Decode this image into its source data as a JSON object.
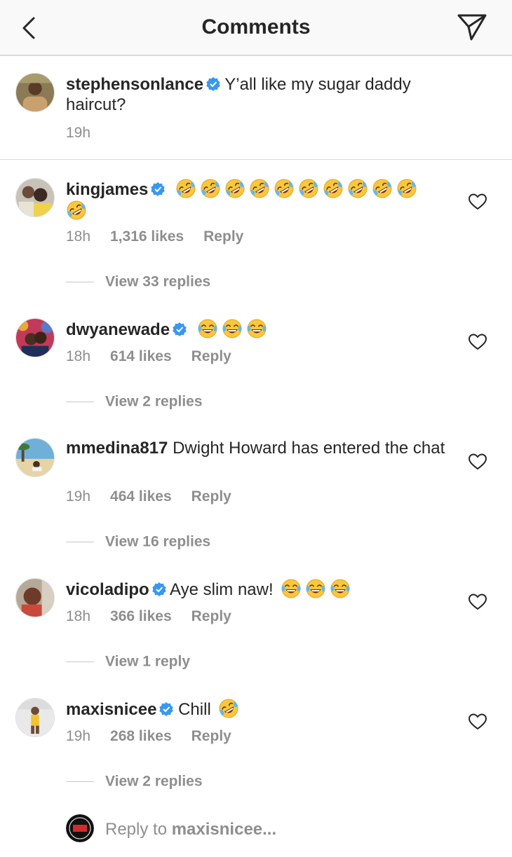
{
  "header": {
    "title": "Comments",
    "back_icon": "chevron-left-icon",
    "send_icon": "paper-plane-icon"
  },
  "caption": {
    "username": "stephensonlance",
    "verified": true,
    "text": "Y’all like my sugar daddy haircut?",
    "time": "19h"
  },
  "comments": [
    {
      "username": "kingjames",
      "verified": true,
      "text": "",
      "emoji": "rolling-on-floor-laughing-icon",
      "emoji_count": 11,
      "time": "18h",
      "likes": "1,316 likes",
      "reply_label": "Reply",
      "view_replies": "View 33 replies"
    },
    {
      "username": "dwyanewade",
      "verified": true,
      "text": "",
      "emoji": "tears-of-joy-icon",
      "emoji_count": 3,
      "time": "18h",
      "likes": "614 likes",
      "reply_label": "Reply",
      "view_replies": "View 2 replies"
    },
    {
      "username": "mmedina817",
      "verified": false,
      "text": "Dwight Howard has entered the chat",
      "emoji": "",
      "emoji_count": 0,
      "time": "19h",
      "likes": "464 likes",
      "reply_label": "Reply",
      "view_replies": "View 16 replies"
    },
    {
      "username": "vicoladipo",
      "verified": true,
      "text": "Aye slim naw!",
      "emoji": "tears-of-joy-icon",
      "emoji_count": 3,
      "time": "18h",
      "likes": "366 likes",
      "reply_label": "Reply",
      "view_replies": "View 1 reply"
    },
    {
      "username": "maxisnicee",
      "verified": true,
      "text": "Chill",
      "emoji": "rolling-on-floor-laughing-icon",
      "emoji_count": 1,
      "time": "19h",
      "likes": "268 likes",
      "reply_label": "Reply",
      "view_replies": "View 2 replies"
    }
  ],
  "reply_input": {
    "prefix": "Reply to ",
    "target": "maxisnicee..."
  },
  "colors": {
    "verified_badge": "#3897f0",
    "muted_text": "#8e8e8e",
    "primary_text": "#262626"
  }
}
